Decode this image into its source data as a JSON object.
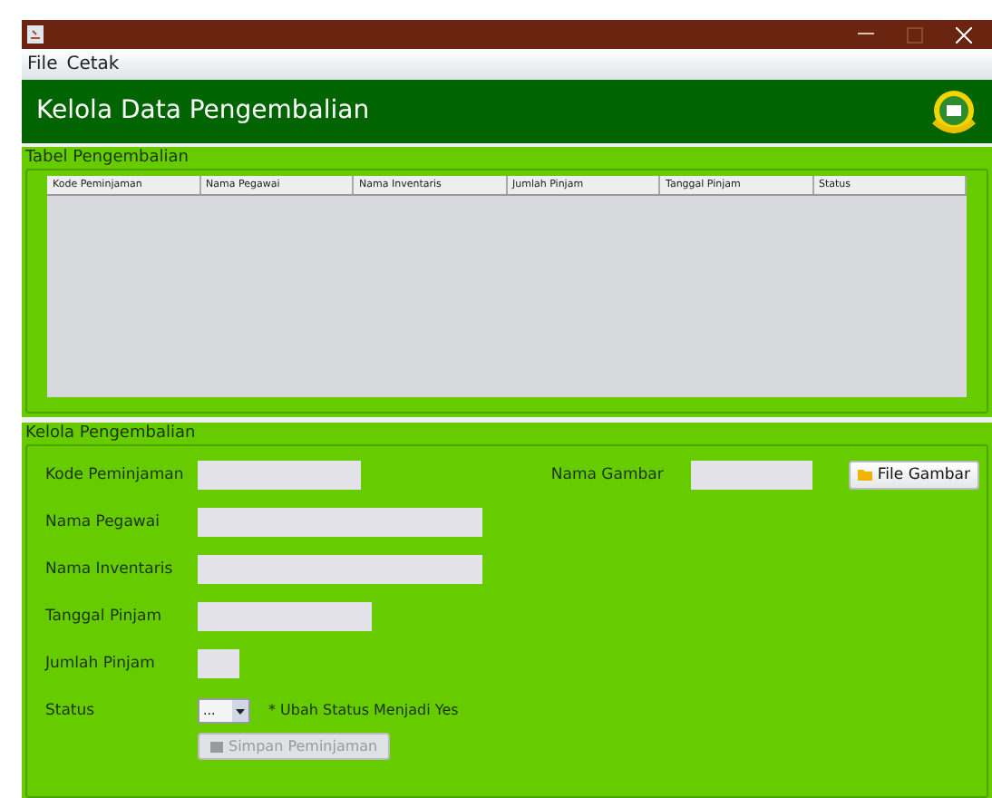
{
  "menu": [
    "File",
    "Cetak"
  ],
  "header": {
    "title": "Kelola Data Pengembalian"
  },
  "table_section": {
    "title": "Tabel Pengembalian",
    "columns": [
      "Kode Peminjaman",
      "Nama Pegawai",
      "Nama Inventaris",
      "Jumlah Pinjam",
      "Tanggal Pinjam",
      "Status"
    ]
  },
  "form_section": {
    "title": "Kelola Pengembalian",
    "fields": [
      {
        "label": "Kode Peminjaman"
      },
      {
        "label": "Nama Pegawai"
      },
      {
        "label": "Nama Inventaris"
      },
      {
        "label": "Tanggal Pinjam"
      },
      {
        "label": "Jumlah Pinjam"
      }
    ],
    "image_name": {
      "label": "Nama Gambar"
    },
    "file_button": {
      "label": "File Gambar"
    },
    "status": {
      "label": "Status",
      "value": "...",
      "note": "* Ubah Status Menjadi Yes"
    },
    "save_button": {
      "label": "Simpan Peminjaman",
      "disabled": true
    }
  }
}
